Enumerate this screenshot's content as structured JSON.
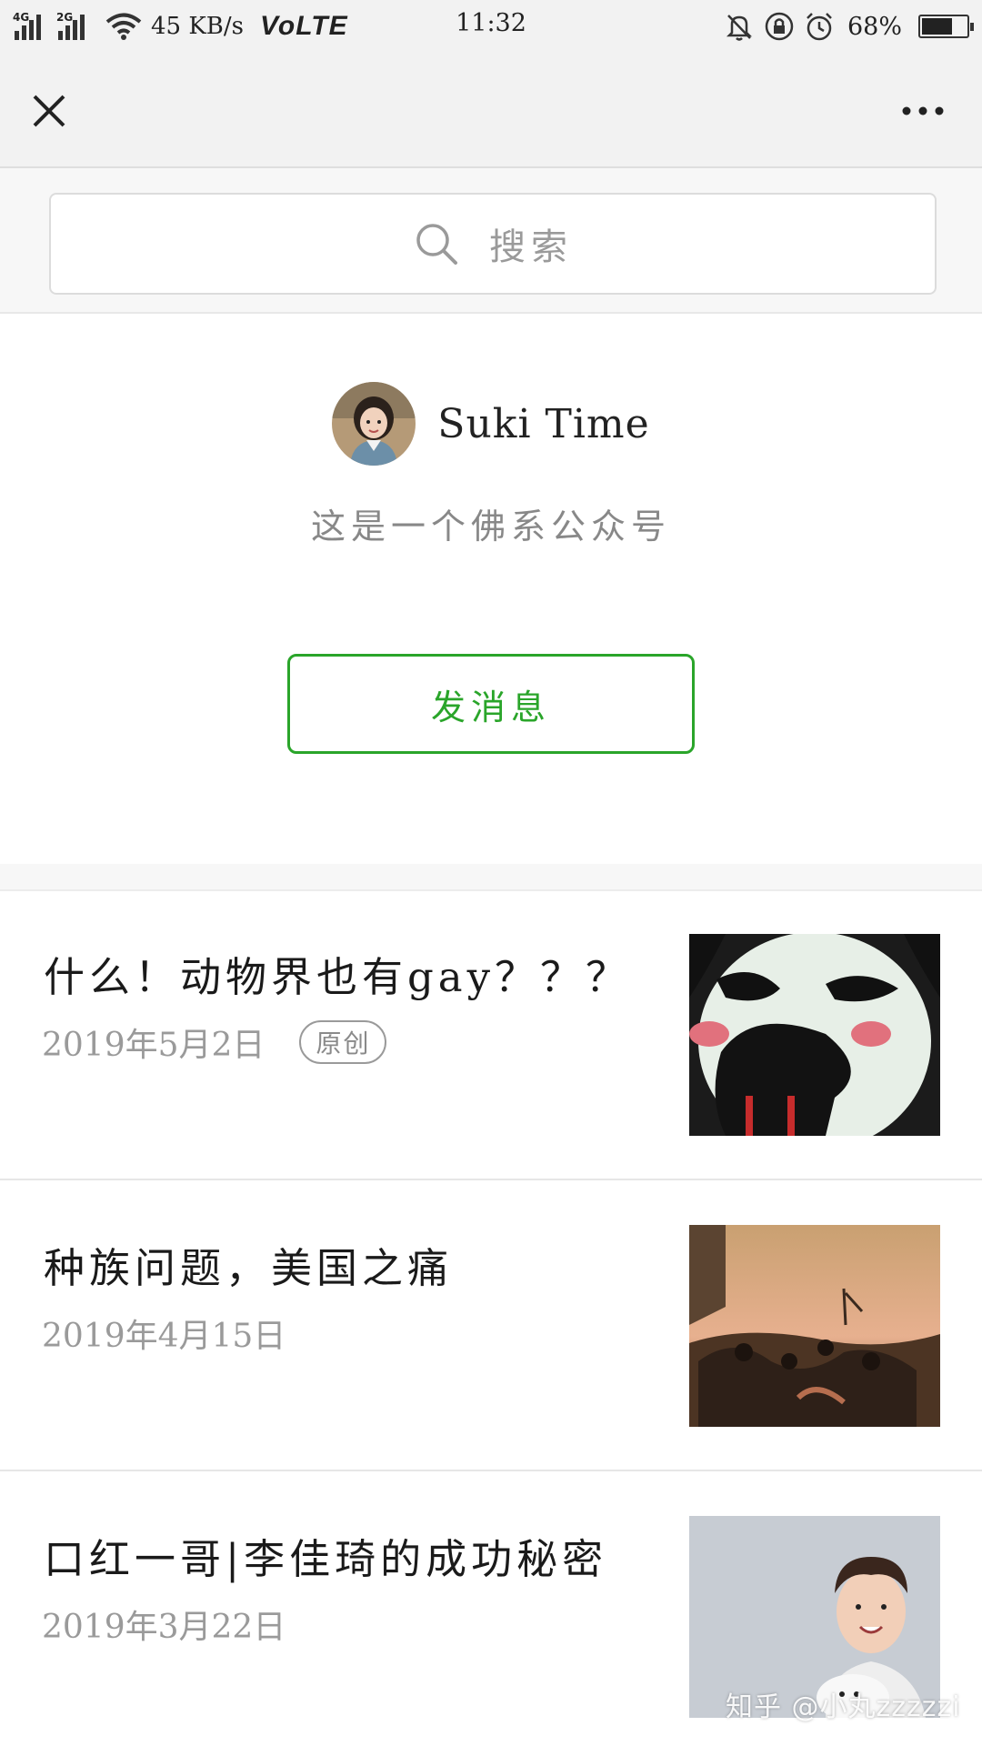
{
  "status_bar": {
    "network_1": "4G",
    "network_2": "2G",
    "speed": "45 KB/s",
    "volte": "VoLTE",
    "time": "11:32",
    "battery": "68%",
    "battery_level": 0.68
  },
  "top_bar": {
    "close_icon": "close-icon",
    "more_icon": "more-dots-icon"
  },
  "search": {
    "placeholder": "搜索",
    "icon": "search-icon"
  },
  "profile": {
    "name": "Suki Time",
    "description": "这是一个佛系公众号",
    "send_button": "发消息",
    "accent_color": "#2aa52a"
  },
  "articles": [
    {
      "title": "什么！动物界也有gay？？？",
      "date": "2019年5月2日",
      "tag": "原创"
    },
    {
      "title": "种族问题，美国之痛",
      "date": "2019年4月15日"
    },
    {
      "title": "口红一哥|李佳琦的成功秘密",
      "date": "2019年3月22日"
    }
  ],
  "watermark": "知乎 @小丸zzzzzi"
}
